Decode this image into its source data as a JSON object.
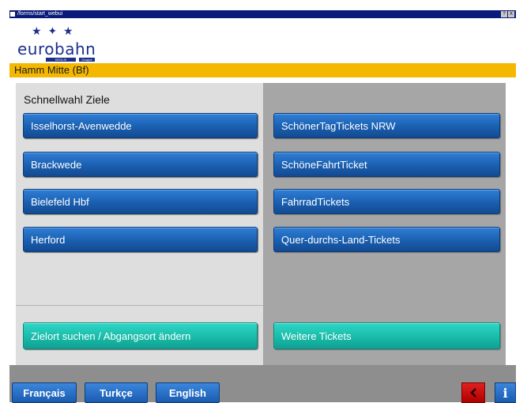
{
  "window": {
    "title": "/forms/start_webui",
    "icons": [
      "?",
      "X"
    ]
  },
  "brand": {
    "logo_text": "eurobahn",
    "logo_sub1": "KEOLIS",
    "logo_sub2": "Gruppe"
  },
  "station": {
    "name": "Hamm Mitte (Bf)"
  },
  "quick_select": {
    "heading": "Schnellwahl Ziele",
    "destinations": [
      "Isselhorst-Avenwedde",
      "Brackwede",
      "Bielefeld Hbf",
      "Herford"
    ],
    "search_label": "Zielort suchen / Abgangsort ändern"
  },
  "tickets": {
    "items": [
      "SchönerTagTickets NRW",
      "SchöneFahrtTicket",
      "FahrradTickets",
      "Quer-durchs-Land-Tickets"
    ],
    "more_label": "Weitere Tickets"
  },
  "footer": {
    "languages": [
      "Français",
      "Turkçe",
      "English"
    ],
    "back_icon": "back-arrow-icon",
    "info_label": "i"
  },
  "colors": {
    "brand_blue": "#1a2f8c",
    "station_bar": "#f5b800",
    "button_blue": "#1a5fb0",
    "button_teal": "#18b9a6",
    "back_red": "#c80000"
  }
}
